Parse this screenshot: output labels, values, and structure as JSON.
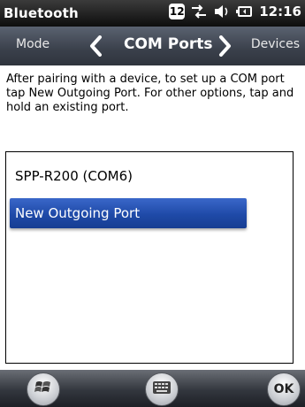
{
  "status_bar": {
    "title": "Bluetooth",
    "badge": "12",
    "time": "12:16",
    "icons": [
      "notification-badge-icon",
      "connectivity-icon",
      "speaker-icon",
      "battery-icon"
    ]
  },
  "nav": {
    "left_tab": "Mode",
    "current_tab": "COM Ports",
    "right_tab": "Devices"
  },
  "instructions": "After pairing with a device, to set up a COM port tap New Outgoing Port. For other options, tap and hold an existing port.",
  "ports_list": {
    "items": [
      {
        "label": "SPP-R200 (COM6)",
        "selected": false
      },
      {
        "label": "New Outgoing Port",
        "selected": true
      }
    ]
  },
  "softkeys": {
    "ok_label": "OK",
    "icons": [
      "windows-start-icon",
      "keyboard-icon"
    ]
  },
  "colors": {
    "selection": "#2350b0",
    "status_bar": "#1a1a1a",
    "nav_bar": "#454b56"
  }
}
